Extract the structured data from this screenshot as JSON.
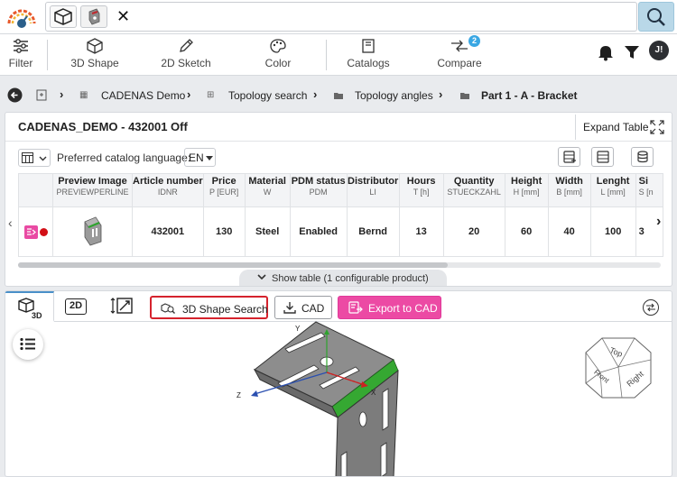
{
  "toolbar": {
    "filter": "Filter",
    "shape3d": "3D Shape",
    "sketch2d": "2D Sketch",
    "color": "Color",
    "catalogs": "Catalogs",
    "compare": "Compare",
    "compare_count": "2",
    "avatar_initials": "J!"
  },
  "breadcrumb": {
    "items": [
      "CADENAS Demo",
      "Topology search",
      "Topology angles",
      "Part 1 - A - Bracket"
    ]
  },
  "card": {
    "title": "CADENAS_DEMO - 432001 Off",
    "expand_label": "Expand Table",
    "lang_label": "Preferred catalog language:",
    "lang_value": "EN",
    "show_table": "Show table (1 configurable product)"
  },
  "table": {
    "columns": [
      {
        "name": "Preview Image",
        "code": "PREVIEWPERLINE"
      },
      {
        "name": "Article number",
        "code": "IDNR"
      },
      {
        "name": "Price",
        "code": "P [EUR]"
      },
      {
        "name": "Material",
        "code": "W"
      },
      {
        "name": "PDM status",
        "code": "PDM"
      },
      {
        "name": "Distributor",
        "code": "LI"
      },
      {
        "name": "Hours",
        "code": "T [h]"
      },
      {
        "name": "Quantity",
        "code": "STUECKZAHL"
      },
      {
        "name": "Height",
        "code": "H [mm]"
      },
      {
        "name": "Width",
        "code": "B [mm]"
      },
      {
        "name": "Lenght",
        "code": "L [mm]"
      },
      {
        "name": "Si",
        "code": "S [n"
      }
    ],
    "row": [
      "",
      "432001",
      "130",
      "Steel",
      "Enabled",
      "Bernd",
      "13",
      "20",
      "60",
      "40",
      "100",
      "3"
    ]
  },
  "viewer": {
    "tab_2d": "2D",
    "shape_search": "3D Shape Search",
    "cad": "CAD",
    "export": "Export to CAD",
    "cube_top": "Top",
    "cube_right": "Right",
    "cube_front": "Front",
    "axis_y": "Y",
    "axis_x": "X",
    "axis_z": "Z"
  },
  "colors": {
    "accent": "#3aa7e3",
    "export": "#ec4aa4",
    "highlight": "#d5232d",
    "edge": "#3fb33a"
  }
}
